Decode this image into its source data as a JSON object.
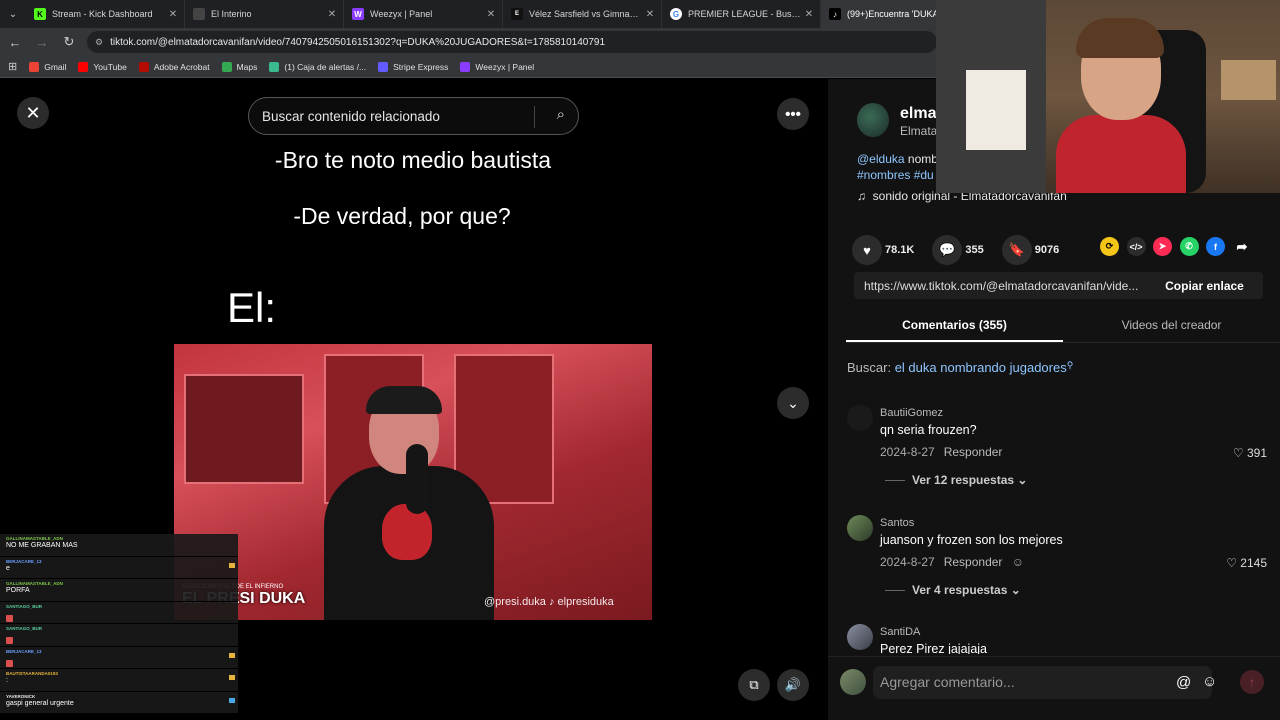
{
  "browser": {
    "tabs": [
      {
        "label": "Stream - Kick Dashboard",
        "icon": "kick-icon",
        "color": "#53fc18"
      },
      {
        "label": "El Interino",
        "icon": "page-icon",
        "color": "#444444"
      },
      {
        "label": "Weezyx | Panel",
        "icon": "weezyx-icon",
        "color": "#8b3dff"
      },
      {
        "label": "Vélez Sarsfield vs Gimnasia La Pl",
        "icon": "espn-icon",
        "color": "#111111"
      },
      {
        "label": "PREMIER LEAGUE - Buscar con Go",
        "icon": "google-icon",
        "color": "#ffffff"
      },
      {
        "label": "(99+)Encuentra 'DUKA JUGADO",
        "icon": "tiktok-icon",
        "color": "#000000"
      }
    ],
    "url": "tiktok.com/@elmatadorcavanifan/video/7407942505016151302?q=DUKA%20JUGADORES&t=1785810140791",
    "bookmarks": [
      {
        "label": "Gmail",
        "color": "#ea4335"
      },
      {
        "label": "YouTube",
        "color": "#ff0000"
      },
      {
        "label": "Adobe Acrobat",
        "color": "#b30b00"
      },
      {
        "label": "Maps",
        "color": "#34a853"
      },
      {
        "label": "(1) Caja de alertas /...",
        "color": "#3bb98f"
      },
      {
        "label": "Stripe Express",
        "color": "#635bff"
      },
      {
        "label": "Weezyx | Panel",
        "color": "#8b3dff"
      }
    ]
  },
  "video": {
    "search_placeholder": "Buscar contenido relacionado",
    "caption_1": "-Bro te noto medio bautista",
    "caption_2": "-De verdad, por que?",
    "caption_3": "El:",
    "watermark": "EL PRESI DUKA",
    "watermark_sub": "REACCIONES DESDE EL INFIERNO",
    "handles": "@presi.duka ♪ elpresiduka"
  },
  "chat": [
    {
      "user": "GALLINAMASTABLE_ADN",
      "msg": "NO ME GRABAN MAS",
      "color": "#7ec84a"
    },
    {
      "user": "BERJACARE_13",
      "msg": "e",
      "color": "#6aa0ff"
    },
    {
      "user": "GALLINAMASTABLE_ADN",
      "msg": "PORFA",
      "color": "#7ec84a"
    },
    {
      "user": "SANTIAGO_BUR",
      "msg": "",
      "color": "#5ad1a0"
    },
    {
      "user": "SANTIAGO_BUR",
      "msg": "",
      "color": "#5ad1a0"
    },
    {
      "user": "BERJACARE_13",
      "msg": "",
      "color": "#6aa0ff"
    },
    {
      "user": "BAUTISTAARANDA0193",
      "msg": ":",
      "color": "#e4b43c"
    },
    {
      "user": "YAVERONICK",
      "msg": "gaspi general urgente",
      "color": "#e9e9e9"
    }
  ],
  "panel": {
    "author_name": "elmat",
    "author_sub": "Elmata",
    "desc_line1_tag": "@elduka",
    "desc_line1_text": "nomb",
    "desc_line2": "#nombres #du",
    "sound": "sonido original - Elmatadorcavanifan",
    "likes": "78.1K",
    "comments": "355",
    "saves": "9076",
    "link": "https://www.tiktok.com/@elmatadorcavanifan/vide...",
    "copy_label": "Copiar enlace",
    "tab_comments": "Comentarios (355)",
    "tab_creator": "Videos del creador",
    "search_label": "Buscar:",
    "search_query": "el duka nombrando jugadores",
    "comments_list": [
      {
        "user": "BautiiGomez",
        "text": "qn seria frouzen?",
        "date": "2024-8-27",
        "reply": "Responder",
        "likes": "391",
        "replies": "Ver 12 respuestas"
      },
      {
        "user": "Santos",
        "text": "juanson y frozen son los mejores",
        "date": "2024-8-27",
        "reply": "Responder",
        "likes": "2145",
        "replies": "Ver 4 respuestas"
      },
      {
        "user": "SantiDA",
        "text": "Perez Pirez jajajaja",
        "date": "",
        "reply": "",
        "likes": "",
        "replies": ""
      }
    ],
    "composer_placeholder": "Agregar comentario..."
  }
}
